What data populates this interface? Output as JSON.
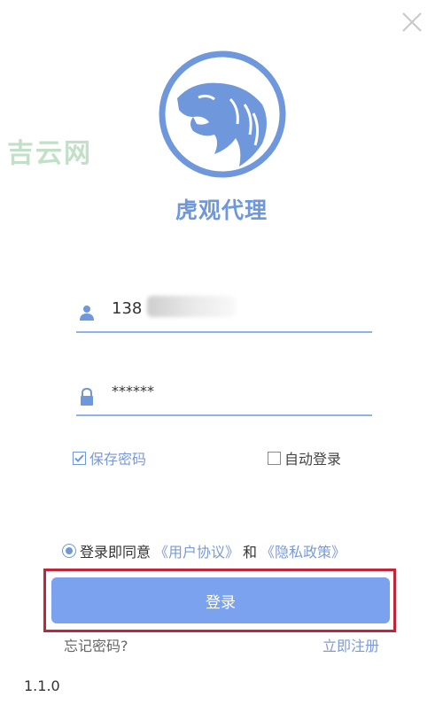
{
  "window": {
    "close_icon": "close-icon"
  },
  "watermark": "吉云网",
  "brand": {
    "logo_icon": "tiger-head-logo",
    "name": "虎观代理"
  },
  "form": {
    "username": {
      "icon": "user-icon",
      "value": "138"
    },
    "password": {
      "icon": "lock-icon",
      "value": "******"
    }
  },
  "options": {
    "save_password": {
      "label": "保存密码",
      "checked": true
    },
    "auto_login": {
      "label": "自动登录",
      "checked": false
    }
  },
  "agreement": {
    "prefix": "登录即同意",
    "user_agreement": "《用户协议》",
    "and": "和",
    "privacy_policy": "《隐私政策》",
    "checked": true
  },
  "login_button": "登录",
  "forgot_password": "忘记密码?",
  "register": "立即注册",
  "version": "1.1.0",
  "colors": {
    "accent": "#6f97dc",
    "button": "#7aa2ee",
    "highlight_border": "#c0263a"
  }
}
